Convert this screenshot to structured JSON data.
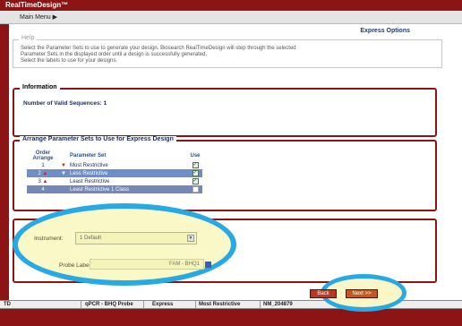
{
  "app": {
    "title": "RealTimeDesign™"
  },
  "menu": {
    "main_label": "Main Menu ▶"
  },
  "page": {
    "title": "Express Options"
  },
  "help": {
    "legend": "Help",
    "lines": [
      "Select the Parameter Sets to use to generate your design. Biosearch RealTimeDesign will step through the selected",
      "Parameter Sets in the displayed order until a design is successfully generated.",
      "Select the labels to use for your designs."
    ]
  },
  "information": {
    "legend": "Information",
    "valid_sequences_label": "Number of Valid Sequences: 1"
  },
  "arrange": {
    "legend": "Arrange Parameter Sets to Use for Express Design",
    "headers": {
      "order": "Order Arrange",
      "set": "Parameter Set",
      "use": "Use"
    },
    "rows": [
      {
        "order": "1",
        "up": "",
        "down": "▼",
        "name": "Most Restrictive",
        "use": true,
        "state": "normal"
      },
      {
        "order": "2",
        "up": "▲",
        "down": "▼",
        "name": "Less Restrictive",
        "use": true,
        "state": "selected"
      },
      {
        "order": "3",
        "up": "▲",
        "down": "",
        "name": "Least Restrictive",
        "use": true,
        "state": "normal"
      },
      {
        "order": "4",
        "up": "",
        "down": "",
        "name": "Least Restrictive 1 Class",
        "use": false,
        "state": "dark"
      }
    ]
  },
  "design": {
    "instrument_label": "Instrument:",
    "instrument_value": "1 Default",
    "probe_label": "Probe Label:",
    "probe_value": "FAM - BHQ1"
  },
  "status": {
    "cells": [
      "TD",
      "qPCR - BHQ Probe",
      "Express",
      "Most Restrictive",
      "NM_204879"
    ]
  },
  "buttons": {
    "back": "Back",
    "next": "Next >>"
  },
  "colors": {
    "brand": "#8c1414",
    "highlight": "#27a9e4",
    "link": "#2b4c9a"
  }
}
